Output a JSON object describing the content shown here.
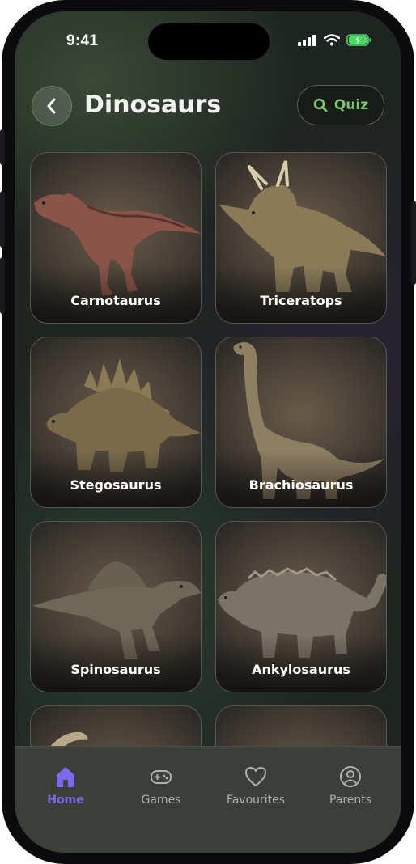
{
  "status_bar": {
    "time": "9:41"
  },
  "header": {
    "title": "Dinosaurs",
    "quiz_label": "Quiz"
  },
  "dinosaurs": [
    {
      "name": "Carnotaurus"
    },
    {
      "name": "Triceratops"
    },
    {
      "name": "Stegosaurus"
    },
    {
      "name": "Brachiosaurus"
    },
    {
      "name": "Spinosaurus"
    },
    {
      "name": "Ankylosaurus"
    }
  ],
  "tabs": [
    {
      "label": "Home",
      "icon": "home-icon",
      "active": true
    },
    {
      "label": "Games",
      "icon": "gamepad-icon",
      "active": false
    },
    {
      "label": "Favourites",
      "icon": "heart-icon",
      "active": false
    },
    {
      "label": "Parents",
      "icon": "user-circle-icon",
      "active": false
    }
  ],
  "colors": {
    "accent": "#7b68ee",
    "quiz_green": "#78c86a"
  }
}
